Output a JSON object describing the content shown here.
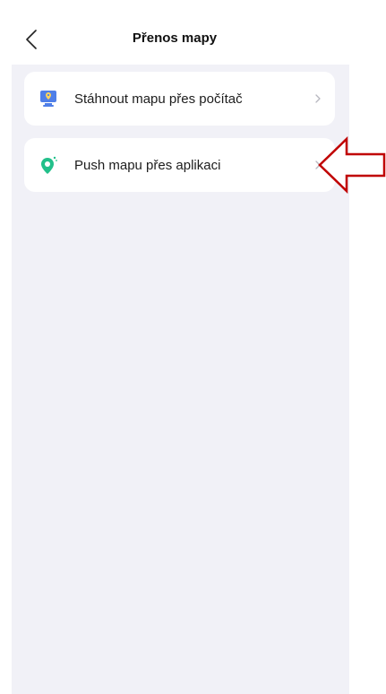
{
  "header": {
    "title": "Přenos mapy",
    "back_icon": "chevron-left-icon"
  },
  "menu": {
    "items": [
      {
        "label": "Stáhnout mapu přes počítač",
        "icon": "computer-map-pin-icon",
        "chevron": "chevron-right-icon"
      },
      {
        "label": "Push mapu přes aplikaci",
        "icon": "map-pin-sparkle-icon",
        "chevron": "chevron-right-icon"
      }
    ]
  },
  "annotation": {
    "icon": "red-outline-arrow-icon",
    "color": "#c00000"
  },
  "colors": {
    "background": "#f1f1f7",
    "card": "#ffffff",
    "accent_blue": "#2f6fe6",
    "accent_green": "#20c28a"
  }
}
